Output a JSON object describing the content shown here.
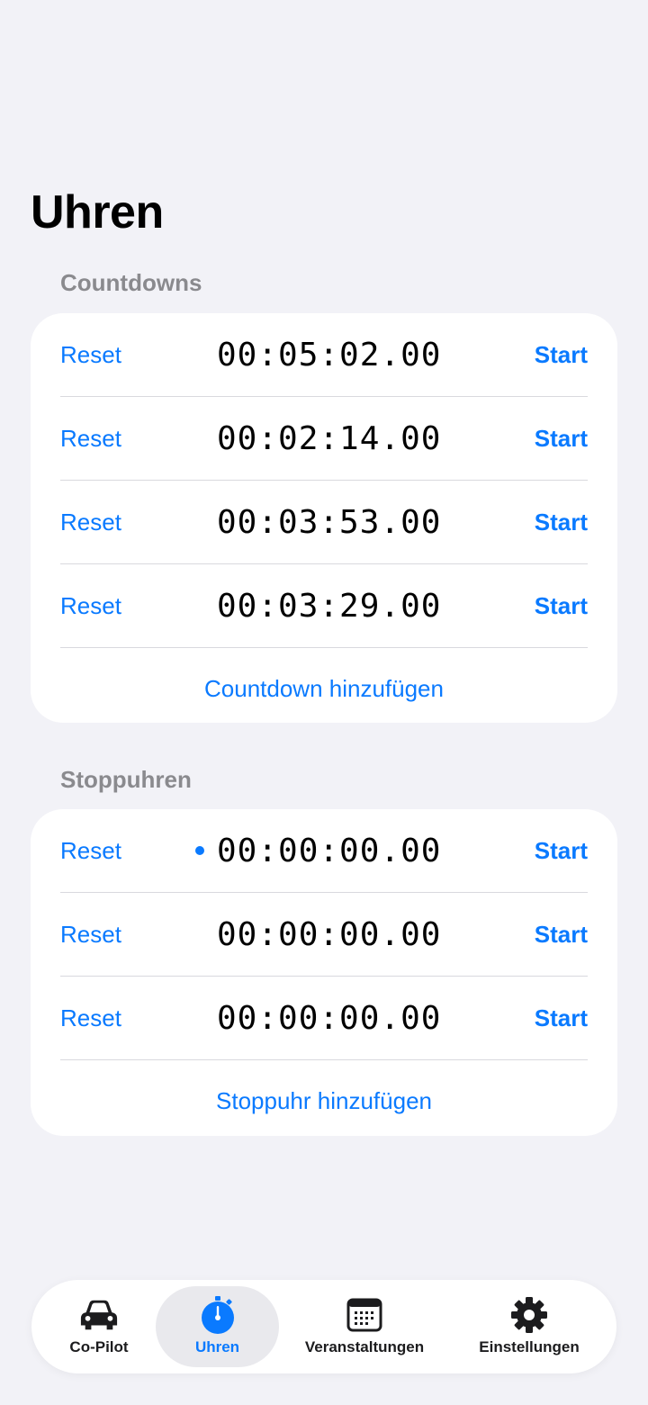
{
  "page": {
    "title": "Uhren"
  },
  "countdowns": {
    "header": "Countdowns",
    "rows": [
      {
        "reset_label": "Reset",
        "time": "00:05:02.00",
        "start_label": "Start"
      },
      {
        "reset_label": "Reset",
        "time": "00:02:14.00",
        "start_label": "Start"
      },
      {
        "reset_label": "Reset",
        "time": "00:03:53.00",
        "start_label": "Start"
      },
      {
        "reset_label": "Reset",
        "time": "00:03:29.00",
        "start_label": "Start"
      }
    ],
    "add_label": "Countdown hinzufügen"
  },
  "stopwatches": {
    "header": "Stoppuhren",
    "rows": [
      {
        "reset_label": "Reset",
        "time": "00:00:00.00",
        "start_label": "Start",
        "active": true
      },
      {
        "reset_label": "Reset",
        "time": "00:00:00.00",
        "start_label": "Start",
        "active": false
      },
      {
        "reset_label": "Reset",
        "time": "00:00:00.00",
        "start_label": "Start",
        "active": false
      }
    ],
    "add_label": "Stoppuhr hinzufügen"
  },
  "tabbar": {
    "tabs": [
      {
        "label": "Co-Pilot",
        "icon": "car-icon",
        "selected": false
      },
      {
        "label": "Uhren",
        "icon": "stopwatch-icon",
        "selected": true
      },
      {
        "label": "Veranstaltungen",
        "icon": "calendar-icon",
        "selected": false
      },
      {
        "label": "Einstellungen",
        "icon": "gear-icon",
        "selected": false
      }
    ]
  },
  "colors": {
    "accent": "#0a7aff",
    "background": "#f2f2f7",
    "card": "#ffffff",
    "section_header": "#8a8a8e"
  }
}
